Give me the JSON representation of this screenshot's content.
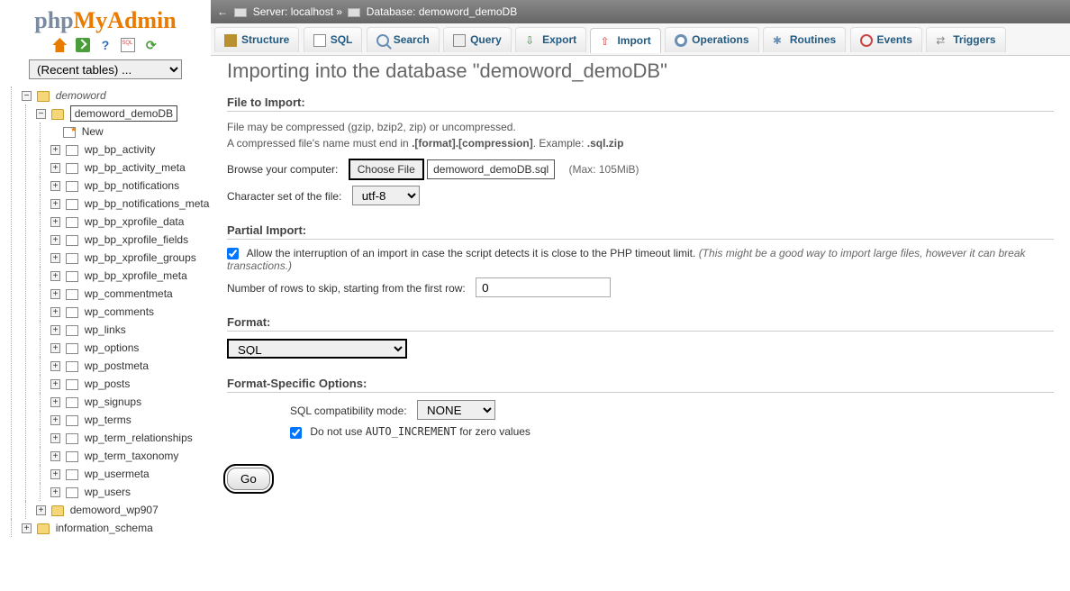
{
  "logo": {
    "p1": "php",
    "p2": "MyAdmin"
  },
  "recent_tables_label": "(Recent tables) ...",
  "breadcrumb": {
    "arrow": "←",
    "server_label": "Server: ",
    "server_value": "localhost",
    "sep": " » ",
    "db_label": "Database: ",
    "db_value": "demoword_demoDB"
  },
  "tabs": {
    "structure": "Structure",
    "sql": "SQL",
    "search": "Search",
    "query": "Query",
    "export": "Export",
    "import": "Import",
    "operations": "Operations",
    "routines": "Routines",
    "events": "Events",
    "triggers": "Triggers"
  },
  "page_title": "Importing into the database \"demoword_demoDB\"",
  "file_to_import": {
    "heading": "File to Import:",
    "note1": "File may be compressed (gzip, bzip2, zip) or uncompressed.",
    "note2_prefix": "A compressed file's name must end in ",
    "note2_bold": ".[format].[compression]",
    "note2_example_label": ". Example: ",
    "note2_example": ".sql.zip",
    "browse_label": "Browse your computer:",
    "choose_btn": "Choose File",
    "chosen_file": "demoword_demoDB.sql",
    "max_size": "(Max: 105MiB)",
    "charset_label": "Character set of the file:",
    "charset_value": "utf-8"
  },
  "partial_import": {
    "heading": "Partial Import:",
    "allow_interrupt_prefix": "Allow the interruption of an import in case the script detects it is close to the PHP timeout limit. ",
    "allow_interrupt_italic": "(This might be a good way to import large files, however it can break transactions.)",
    "skip_label": "Number of rows to skip, starting from the first row:",
    "skip_value": "0"
  },
  "format": {
    "heading": "Format:",
    "value": "SQL"
  },
  "format_options": {
    "heading": "Format-Specific Options:",
    "compat_label": "SQL compatibility mode:",
    "compat_value": "NONE",
    "no_autoinc_prefix": "Do not use ",
    "no_autoinc_code": "AUTO_INCREMENT",
    "no_autoinc_suffix": " for zero values"
  },
  "go_label": "Go",
  "tree": {
    "server": "demoword",
    "current_db": "demoword_demoDB",
    "new_label": "New",
    "tables": [
      "wp_bp_activity",
      "wp_bp_activity_meta",
      "wp_bp_notifications",
      "wp_bp_notifications_meta",
      "wp_bp_xprofile_data",
      "wp_bp_xprofile_fields",
      "wp_bp_xprofile_groups",
      "wp_bp_xprofile_meta",
      "wp_commentmeta",
      "wp_comments",
      "wp_links",
      "wp_options",
      "wp_postmeta",
      "wp_posts",
      "wp_signups",
      "wp_terms",
      "wp_term_relationships",
      "wp_term_taxonomy",
      "wp_usermeta",
      "wp_users"
    ],
    "other_db": "demoword_wp907",
    "info_schema": "information_schema"
  }
}
